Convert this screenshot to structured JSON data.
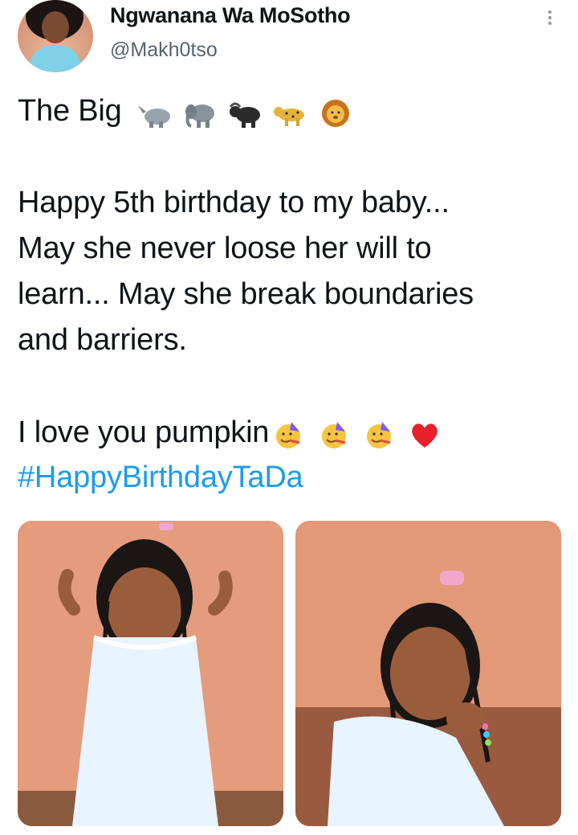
{
  "tweet": {
    "author_name": "Ngwanana Wa MoSotho",
    "author_handle": "@Makh0tso",
    "lines": [
      "The Big",
      "Happy 5th birthday to my baby...",
      "May she never loose her will to",
      "learn... May she break boundaries",
      "and barriers.",
      "I love you pumpkin",
      "#HappyBirthdayTaDa"
    ],
    "emoji_sequence_1": [
      "rhino-emoji",
      "elephant-emoji",
      "buffalo-emoji",
      "leopard-emoji",
      "lion-emoji"
    ],
    "emoji_sequence_2": [
      "party-face-emoji",
      "party-face-emoji",
      "party-face-emoji",
      "red-heart-emoji"
    ]
  },
  "media": {
    "photo_count": 2
  }
}
